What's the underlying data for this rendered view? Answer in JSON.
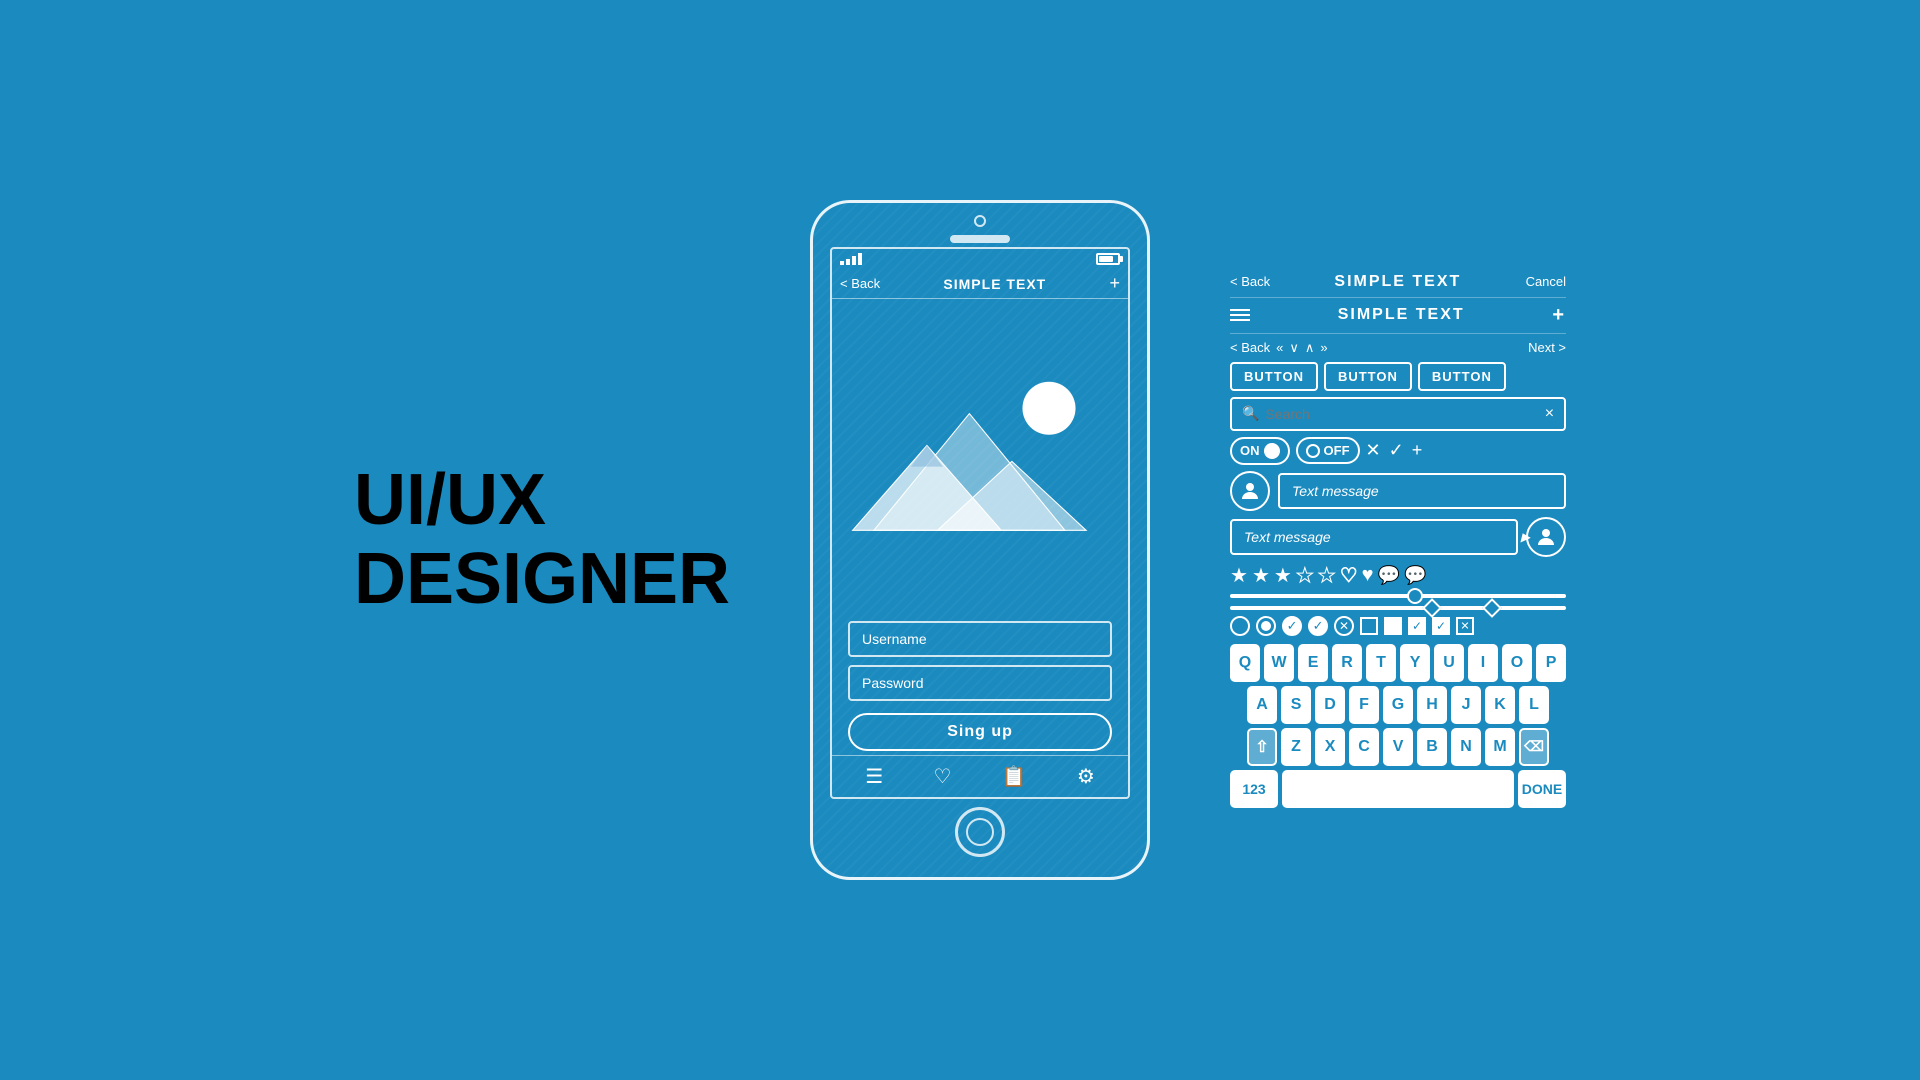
{
  "title": {
    "line1": "UI/UX",
    "line2": "DESIGNER"
  },
  "phone": {
    "nav": {
      "back": "< Back",
      "title": "SIMPLE TEXT",
      "plus": "+"
    },
    "form": {
      "username_placeholder": "Username",
      "password_placeholder": "Password",
      "button_label": "Sing up"
    },
    "bottom_nav_icons": [
      "menu",
      "heart",
      "note",
      "settings"
    ]
  },
  "uikit": {
    "nav_row": {
      "back": "< Back",
      "prev_prev": "«",
      "chevron_down": "∨",
      "chevron_up": "∧",
      "next_next": "»",
      "next": "Next >"
    },
    "title_row": {
      "hamburger": "≡",
      "title": "SIMPLE TEXT",
      "plus": "+"
    },
    "header_row": {
      "back": "< Back",
      "title": "SIMPLE TEXT",
      "cancel": "Cancel"
    },
    "buttons": [
      "BUTTON",
      "BUTTON",
      "BUTTON"
    ],
    "search": {
      "placeholder": "Search",
      "clear": "×"
    },
    "toggle_on": "ON",
    "toggle_off": "OFF",
    "chat": {
      "left_placeholder": "Text message",
      "right_placeholder": "Text message"
    },
    "keyboard": {
      "row1": [
        "Q",
        "W",
        "E",
        "R",
        "T",
        "Y",
        "U",
        "I",
        "O",
        "P"
      ],
      "row2": [
        "A",
        "S",
        "D",
        "F",
        "G",
        "H",
        "J",
        "K",
        "L"
      ],
      "row3": [
        "Z",
        "X",
        "C",
        "V",
        "B",
        "N",
        "M"
      ],
      "num_label": "123",
      "done_label": "DONE"
    }
  },
  "colors": {
    "bg": "#1a8abf",
    "white": "#ffffff",
    "text_dark": "#000000"
  }
}
